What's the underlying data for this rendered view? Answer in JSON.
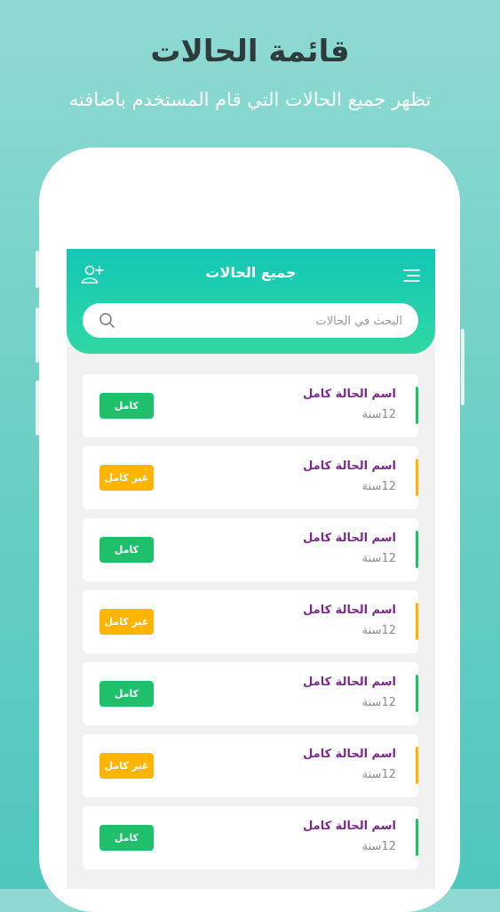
{
  "promo": {
    "title": "قائمة الحالات",
    "subtitle": "تظهر جميع الحالات التي قام المستخدم باضافته"
  },
  "header": {
    "title": "جميع الحالات",
    "menu_icon": "menu-icon",
    "add_icon": "add-user-icon"
  },
  "search": {
    "placeholder": "البحث في الحالات",
    "value": "",
    "icon": "search-icon"
  },
  "colors": {
    "header_start": "#12c7b5",
    "header_end": "#2fd8a4",
    "complete": "#1fbf6c",
    "incomplete": "#ffb400",
    "name_text": "#7a2a8a"
  },
  "cases": [
    {
      "name": "اسم الحالة كامل",
      "age": "12سنة",
      "status": "كامل",
      "complete": true
    },
    {
      "name": "اسم الحالة كامل",
      "age": "12سنة",
      "status": "غير كامل",
      "complete": false
    },
    {
      "name": "اسم الحالة كامل",
      "age": "12سنة",
      "status": "كامل",
      "complete": true
    },
    {
      "name": "اسم الحالة كامل",
      "age": "12سنة",
      "status": "غير كامل",
      "complete": false
    },
    {
      "name": "اسم الحالة كامل",
      "age": "12سنة",
      "status": "كامل",
      "complete": true
    },
    {
      "name": "اسم الحالة كامل",
      "age": "12سنة",
      "status": "غير كامل",
      "complete": false
    },
    {
      "name": "اسم الحالة كامل",
      "age": "12سنة",
      "status": "كامل",
      "complete": true
    }
  ]
}
